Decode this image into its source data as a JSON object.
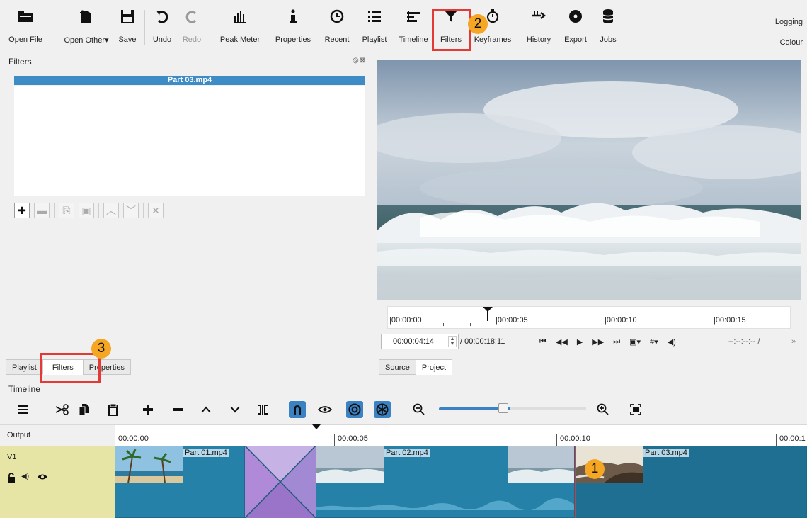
{
  "toolbar": {
    "items": [
      {
        "label": "Open File",
        "icon": "folder-icon"
      },
      {
        "label": "Open Other",
        "icon": "open-other-icon"
      },
      {
        "label": "Save",
        "icon": "save-icon"
      },
      {
        "label": "Undo",
        "icon": "undo-icon"
      },
      {
        "label": "Redo",
        "icon": "redo-icon",
        "disabled": true
      },
      {
        "label": "Peak Meter",
        "icon": "peak-meter-icon"
      },
      {
        "label": "Properties",
        "icon": "info-icon"
      },
      {
        "label": "Recent",
        "icon": "clock-icon"
      },
      {
        "label": "Playlist",
        "icon": "list-icon"
      },
      {
        "label": "Timeline",
        "icon": "timeline-icon"
      },
      {
        "label": "Filters",
        "icon": "funnel-icon"
      },
      {
        "label": "Keyframes",
        "icon": "stopwatch-icon"
      },
      {
        "label": "History",
        "icon": "history-icon"
      },
      {
        "label": "Export",
        "icon": "disc-icon"
      },
      {
        "label": "Jobs",
        "icon": "database-icon"
      }
    ],
    "layout_right": [
      "Logging",
      "Colour"
    ]
  },
  "filters_panel": {
    "title": "Filters",
    "clip_name": "Part 03.mp4",
    "panel_controls": "◎⊠"
  },
  "left_tabs": [
    "Playlist",
    "Filters",
    "Properties"
  ],
  "player": {
    "ruler_labels": [
      "|00:00:00",
      "|00:00:05",
      "|00:00:10",
      "|00:00:15"
    ],
    "timecode": "00:00:04:14",
    "duration": "/ 00:00:18:11",
    "in_out": "--:--:--:-- /",
    "more": "»",
    "tabs": [
      "Source",
      "Project"
    ]
  },
  "timeline": {
    "title": "Timeline",
    "output_label": "Output",
    "track_label": "V1",
    "ruler_labels": [
      "00:00:00",
      "00:00:05",
      "00:00:10",
      "00:00:1"
    ],
    "clips": [
      "Part 01.mp4",
      "Part 02.mp4",
      "Part 03.mp4"
    ]
  },
  "annotations": {
    "badge_1": "1",
    "badge_2": "2",
    "badge_3": "3",
    "highlight_color": "#e53935",
    "badge_color": "#f5a623"
  }
}
